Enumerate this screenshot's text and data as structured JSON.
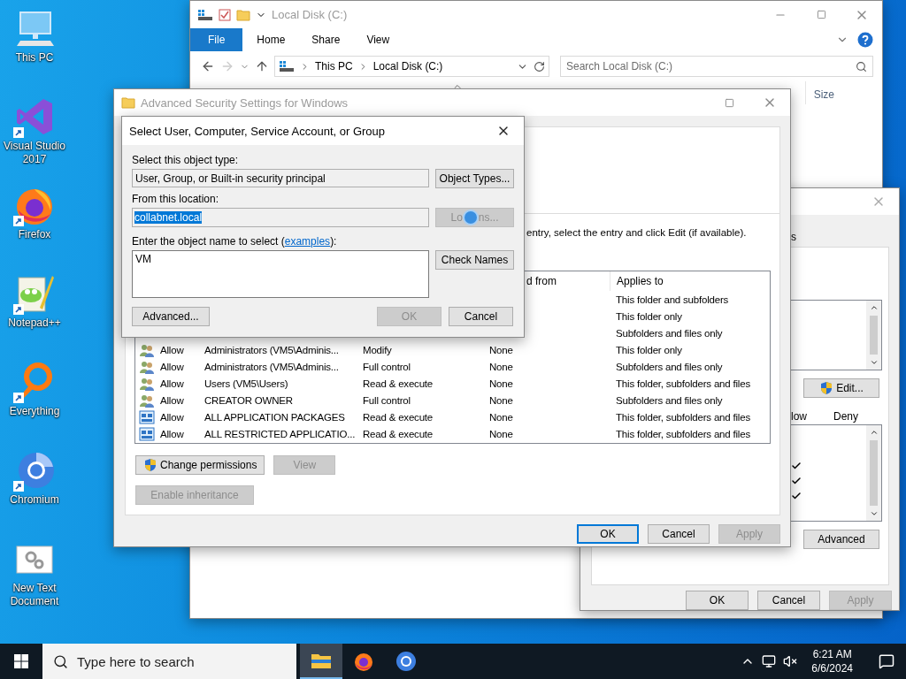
{
  "desktop_icons": [
    {
      "label": "This PC",
      "kind": "pc",
      "shortcut": false
    },
    {
      "label": "Visual Studio 2017",
      "kind": "vs",
      "shortcut": true
    },
    {
      "label": "Firefox",
      "kind": "firefox",
      "shortcut": true
    },
    {
      "label": "Notepad++",
      "kind": "notepad",
      "shortcut": true
    },
    {
      "label": "Everything",
      "kind": "everything",
      "shortcut": true
    },
    {
      "label": "Chromium",
      "kind": "chromium",
      "shortcut": true
    },
    {
      "label": "New Text Document",
      "kind": "textdoc",
      "shortcut": false
    }
  ],
  "explorer": {
    "title": "Local Disk (C:)",
    "ribbon_tabs": [
      {
        "label": "File",
        "kind": "file"
      },
      {
        "label": "Home",
        "kind": "tab"
      },
      {
        "label": "Share",
        "kind": "tab"
      },
      {
        "label": "View",
        "kind": "tab"
      }
    ],
    "path": [
      "This PC",
      "Local Disk (C:)"
    ],
    "search": {
      "placeholder": "Search Local Disk (C:)"
    },
    "columns": [
      "Size"
    ]
  },
  "permissions_window": {
    "tab_fragment": "s",
    "edit_button": {
      "label": "Edit...",
      "shield": true
    },
    "columns": [
      "low",
      "Deny"
    ],
    "allow_checks": [
      {
        "checked": true
      },
      {
        "checked": true
      },
      {
        "checked": true
      }
    ],
    "advanced_button": "Advanced",
    "buttons": [
      {
        "label": "OK",
        "disabled": false,
        "default": false
      },
      {
        "label": "Cancel",
        "disabled": false,
        "default": false
      },
      {
        "label": "Apply",
        "disabled": true,
        "default": false
      }
    ]
  },
  "advanced_security": {
    "title": "Advanced Security Settings for Windows",
    "instruction": "entry, select the entry and click Edit (if available).",
    "columns": [
      "d from",
      "Applies to"
    ],
    "entries": [
      {
        "kind": "partial",
        "applies_to": "This folder and subfolders"
      },
      {
        "kind": "partial",
        "applies_to": "This folder only"
      },
      {
        "kind": "partial",
        "applies_to": "Subfolders and files only"
      },
      {
        "kind": "user",
        "type": "Allow",
        "principal": "Administrators (VM5\\Adminis...",
        "access": "Modify",
        "inherited_from": "None",
        "applies_to": "This folder only"
      },
      {
        "kind": "user",
        "type": "Allow",
        "principal": "Administrators (VM5\\Adminis...",
        "access": "Full control",
        "inherited_from": "None",
        "applies_to": "Subfolders and files only"
      },
      {
        "kind": "user",
        "type": "Allow",
        "principal": "Users (VM5\\Users)",
        "access": "Read & execute",
        "inherited_from": "None",
        "applies_to": "This folder, subfolders and files"
      },
      {
        "kind": "user",
        "type": "Allow",
        "principal": "CREATOR OWNER",
        "access": "Full control",
        "inherited_from": "None",
        "applies_to": "Subfolders and files only"
      },
      {
        "kind": "package",
        "type": "Allow",
        "principal": "ALL APPLICATION PACKAGES",
        "access": "Read & execute",
        "inherited_from": "None",
        "applies_to": "This folder, subfolders and files"
      },
      {
        "kind": "package",
        "type": "Allow",
        "principal": "ALL RESTRICTED APPLICATIO...",
        "access": "Read & execute",
        "inherited_from": "None",
        "applies_to": "This folder, subfolders and files"
      }
    ],
    "list_buttons": [
      {
        "label": "Change permissions",
        "shield": true,
        "disabled": false
      },
      {
        "label": "View",
        "shield": false,
        "disabled": true
      }
    ],
    "inheritance_button": {
      "label": "Enable inheritance",
      "disabled": true
    },
    "buttons": [
      {
        "label": "OK",
        "disabled": false,
        "default": true
      },
      {
        "label": "Cancel",
        "disabled": false,
        "default": false
      },
      {
        "label": "Apply",
        "disabled": true,
        "default": false
      }
    ]
  },
  "select_dialog": {
    "title": "Select User, Computer, Service Account, or Group",
    "object_type_label": "Select this object type:",
    "object_type": "User, Group, or Built-in security principal",
    "object_types_button": "Object Types...",
    "location_label": "From this location:",
    "location": {
      "value": "collabnet.local",
      "selected": true
    },
    "locations_button": {
      "label_start": "Lo",
      "label_end": "ns...",
      "disabled": true
    },
    "name_label": "Enter the object name to select (",
    "name_link": "examples",
    "name_label_end": "):",
    "names": "VM",
    "check_names_button": "Check Names",
    "advanced_button": "Advanced...",
    "buttons": [
      {
        "label": "OK",
        "disabled": true,
        "default": false
      },
      {
        "label": "Cancel",
        "disabled": false,
        "default": false
      }
    ]
  },
  "taskbar": {
    "search": {
      "placeholder": "Type here to search"
    },
    "apps": [
      {
        "kind": "explorer",
        "selected": true
      },
      {
        "kind": "firefox",
        "selected": false
      },
      {
        "kind": "chromium",
        "selected": false
      }
    ],
    "time": "6:21 AM",
    "date": "6/6/2024"
  }
}
